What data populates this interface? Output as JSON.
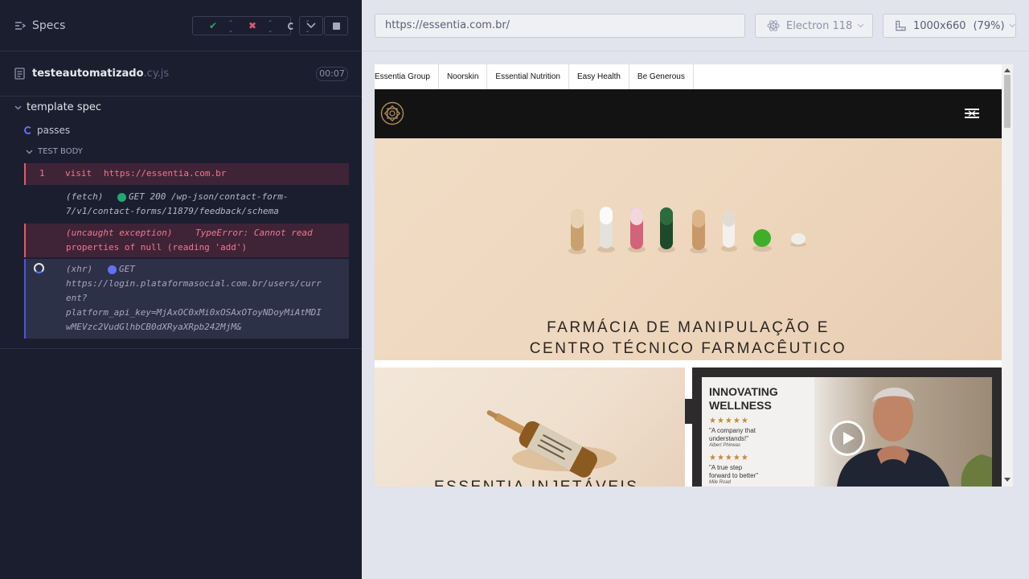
{
  "reporter": {
    "specs_label": "Specs",
    "stats": {
      "passed": "--",
      "failed": "--",
      "pending": "--"
    },
    "file": {
      "name": "testeautomatizado",
      "ext": ".cy.js",
      "duration": "00:07"
    },
    "suite": "template spec",
    "test": "passes",
    "body_label": "TEST BODY",
    "commands": [
      {
        "num": "1",
        "name": "visit",
        "message": "https://essentia.com.br"
      },
      {
        "name": "(fetch)",
        "message_l1": "GET 200 /wp-json/contact-form-",
        "message_l2": "7/v1/contact-forms/11879/feedback/schema"
      },
      {
        "name": "(uncaught exception)",
        "message_l1": "TypeError: Cannot read",
        "message_l2": "properties of null (reading 'add')"
      },
      {
        "name": "(xhr)",
        "method": "GET",
        "lines": [
          "https://login.plataformasocial.com.br/users/curr",
          "ent?",
          "platform_api_key=MjAxOC0xMi0xOSAxOToyNDoyMiAtMDI",
          "wMEVzc2VudGlhbCB0dXRyaXRpb242MjM&"
        ]
      }
    ]
  },
  "browser": {
    "url": "https://essentia.com.br/",
    "browser_name": "Electron 118",
    "viewport": "1000x660",
    "scale": "(79%)"
  },
  "site": {
    "brands": [
      "Essentia Group",
      "Noorskin",
      "Essential Nutrition",
      "Easy Health",
      "Be Generous"
    ],
    "hero_line1": "FARMÁCIA DE MANIPULAÇÃO E",
    "hero_line2": "CENTRO TÉCNICO FARMACÊUTICO",
    "tile1_title": "ESSENTIA INJETÁVEIS",
    "video": {
      "title1": "INNOVATING",
      "title2": "WELLNESS",
      "stars": "★★★★★",
      "quote1_l1": "\"A company that",
      "quote1_l2": "understands!\"",
      "author1": "Albert Phineas",
      "quote2_l1": "\"A true step",
      "quote2_l2": "forward to better\"",
      "author2": "Mile Road"
    }
  },
  "colors": {
    "reporter_bg": "#1b1e2e",
    "error_bg": "#3f2437",
    "error_accent": "#e45770",
    "xhr_bg": "#2d3148",
    "xhr_accent": "#4956e3",
    "success": "#1fa971"
  }
}
